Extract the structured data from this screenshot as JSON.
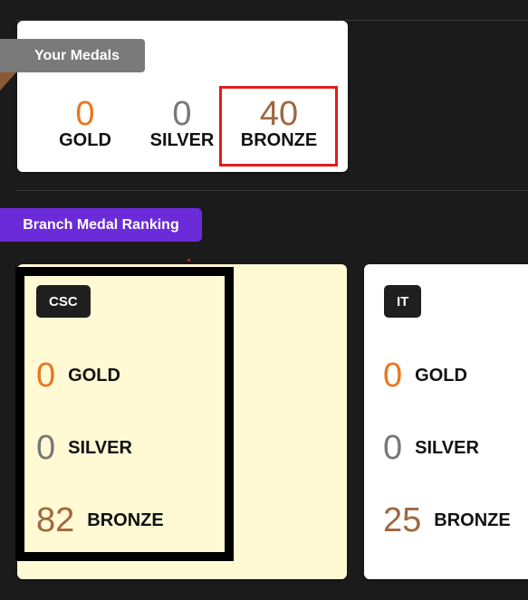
{
  "your_medals": {
    "title": "Your Medals",
    "gold": {
      "value": "0",
      "label": "GOLD"
    },
    "silver": {
      "value": "0",
      "label": "SILVER"
    },
    "bronze": {
      "value": "40",
      "label": "BRONZE"
    }
  },
  "branch_ranking": {
    "title": "Branch Medal Ranking",
    "branches": [
      {
        "name": "CSC",
        "gold": "0",
        "gold_label": "GOLD",
        "silver": "0",
        "silver_label": "SILVER",
        "bronze": "82",
        "bronze_label": "BRONZE"
      },
      {
        "name": "IT",
        "gold": "0",
        "gold_label": "GOLD",
        "silver": "0",
        "silver_label": "SILVER",
        "bronze": "25",
        "bronze_label": "BRONZE"
      }
    ]
  },
  "colors": {
    "background": "#1c1b1c",
    "gold": "#e87722",
    "silver": "#777777",
    "bronze": "#a0673f",
    "highlight_card": "#fff9d4",
    "ribbon_purple": "#6c2bd9",
    "ribbon_gray": "#7a7a7a",
    "annotation_red": "#e11d1d"
  }
}
